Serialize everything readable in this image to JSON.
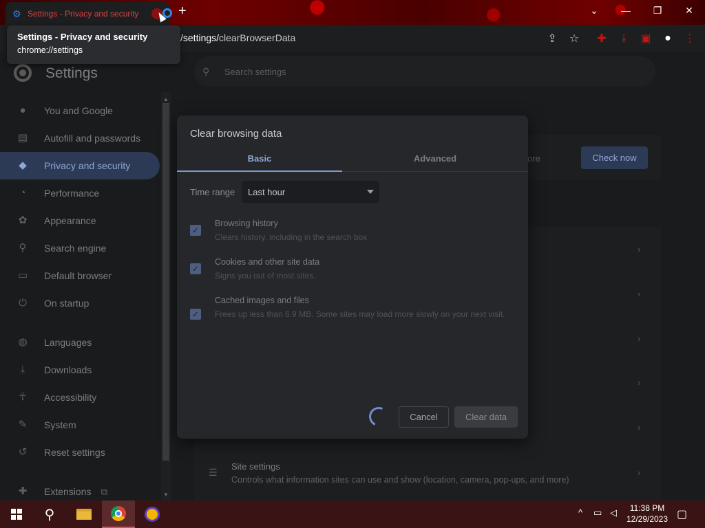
{
  "window": {
    "tab_title": "Settings - Privacy and security",
    "new_tab_symbol": "+",
    "controls": {
      "dropdown": "⌄",
      "minimize": "—",
      "restore": "❐",
      "close": "✕"
    }
  },
  "tooltip": {
    "title": "Settings - Privacy and security",
    "url": "chrome://settings"
  },
  "toolbar": {
    "url_visible_prefix": "/settings/",
    "url_visible_suffix": "clearBrowserData"
  },
  "header": {
    "title": "Settings",
    "search_placeholder": "Search settings"
  },
  "sidebar": {
    "items": [
      {
        "label": "You and Google",
        "icon": "person-icon"
      },
      {
        "label": "Autofill and passwords",
        "icon": "clipboard-icon"
      },
      {
        "label": "Privacy and security",
        "icon": "shield-icon",
        "active": true
      },
      {
        "label": "Performance",
        "icon": "speedometer-icon"
      },
      {
        "label": "Appearance",
        "icon": "palette-icon"
      },
      {
        "label": "Search engine",
        "icon": "search-icon"
      },
      {
        "label": "Default browser",
        "icon": "browser-icon"
      },
      {
        "label": "On startup",
        "icon": "power-icon"
      },
      {
        "label": "Languages",
        "icon": "globe-icon"
      },
      {
        "label": "Downloads",
        "icon": "download-icon"
      },
      {
        "label": "Accessibility",
        "icon": "accessibility-icon"
      },
      {
        "label": "System",
        "icon": "wrench-icon"
      },
      {
        "label": "Reset settings",
        "icon": "reset-icon"
      },
      {
        "label": "Extensions",
        "icon": "puzzle-icon"
      }
    ]
  },
  "main": {
    "check_now": "Check now",
    "partial_text": "ore",
    "site_settings": {
      "title": "Site settings",
      "description": "Controls what information sites can use and show (location, camera, pop-ups, and more)"
    }
  },
  "dialog": {
    "title": "Clear browsing data",
    "tabs": {
      "basic": "Basic",
      "advanced": "Advanced"
    },
    "time_range_label": "Time range",
    "time_range_value": "Last hour",
    "options": [
      {
        "title": "Browsing history",
        "description": "Clears history, including in the search box",
        "checked": true
      },
      {
        "title": "Cookies and other site data",
        "description": "Signs you out of most sites.",
        "checked": true
      },
      {
        "title": "Cached images and files",
        "description": "Frees up less than 6.9 MB. Some sites may load more slowly on your next visit.",
        "checked": true
      }
    ],
    "cancel": "Cancel",
    "clear": "Clear data"
  },
  "taskbar": {
    "time": "11:38 PM",
    "date": "12/29/2023"
  },
  "colors": {
    "accent": "#8ea6d6",
    "titlebar": "#6e0000",
    "taskbar": "#3a1315"
  }
}
